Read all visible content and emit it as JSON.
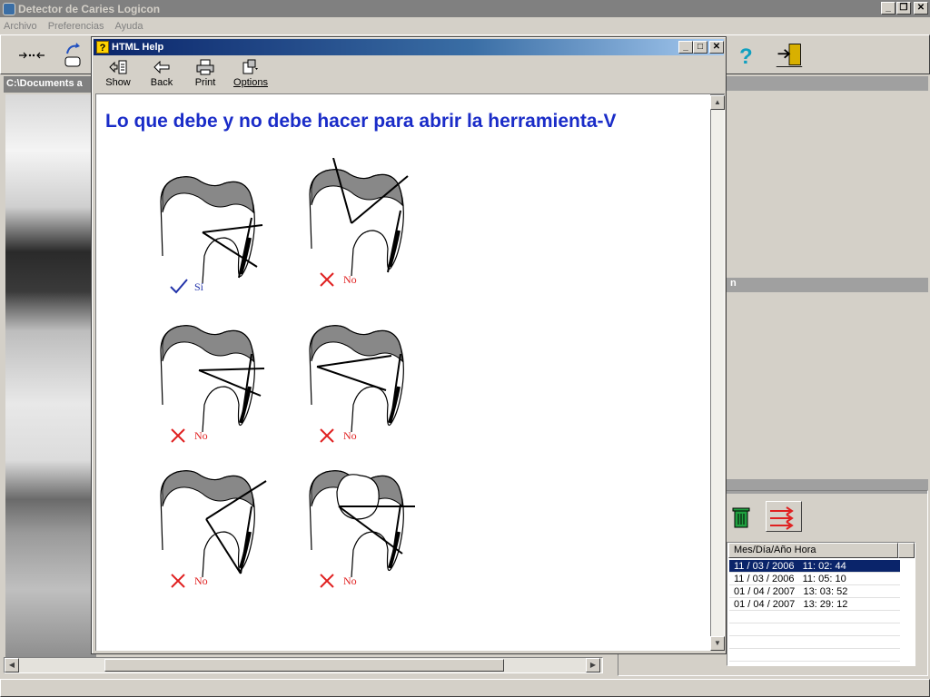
{
  "main_window": {
    "title": "Detector de Caries Logicon",
    "menu": [
      "Archivo",
      "Preferencias",
      "Ayuda"
    ],
    "path": "C:\\Documents a",
    "right_header_fragment": "n"
  },
  "help_window": {
    "title": "HTML Help",
    "toolbar": {
      "show": "Show",
      "back": "Back",
      "print": "Print",
      "options": "Options"
    },
    "heading": "Lo que debe y no debe hacer para abrir la herramienta-V",
    "examples": [
      {
        "verdict": "correct",
        "label": "Sí"
      },
      {
        "verdict": "wrong",
        "label": "No"
      },
      {
        "verdict": "wrong",
        "label": "No"
      },
      {
        "verdict": "wrong",
        "label": "No"
      },
      {
        "verdict": "wrong",
        "label": "No"
      },
      {
        "verdict": "wrong",
        "label": "No"
      }
    ]
  },
  "records_table": {
    "header": "Mes/Día/Año  Hora",
    "rows": [
      "11 / 03 / 2006   11: 02: 44",
      "11 / 03 / 2006   11: 05: 10",
      "01 / 04 / 2007   13: 03: 52",
      "01 / 04 / 2007   13: 29: 12"
    ],
    "selected_index": 0
  },
  "colors": {
    "heading": "#1a2cc8",
    "check": "#2233aa",
    "cross": "#e02020",
    "selection": "#0a246a"
  }
}
